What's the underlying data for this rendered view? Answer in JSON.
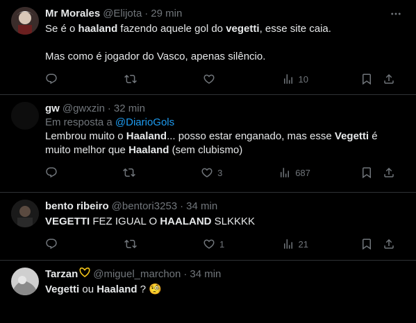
{
  "tweets": [
    {
      "name": "Mr Morales",
      "handle": "@Elijota",
      "time": "29 min",
      "text1_a": "Se é o ",
      "text1_b": "haaland",
      "text1_c": " fazendo aquele gol do ",
      "text1_d": "vegetti",
      "text1_e": ", esse site caia.",
      "text2": "Mas como é jogador do Vasco, apenas  silêncio.",
      "replies": "",
      "retweets": "",
      "likes": "",
      "views": "10"
    },
    {
      "name": "gw",
      "handle": "@gwxzin",
      "time": "32 min",
      "reply_prefix": "Em resposta a ",
      "reply_mention": "@DiarioGols",
      "t_a": "Lembrou muito o ",
      "t_b": "Haaland",
      "t_c": "... posso estar enganado, mas esse ",
      "t_d": "Vegetti",
      "t_e": " é muito melhor que ",
      "t_f": "Haaland",
      "t_g": " (sem clubismo)",
      "replies": "",
      "retweets": "",
      "likes": "3",
      "views": "687"
    },
    {
      "name": "bento ribeiro",
      "handle": "@bentori3253",
      "time": "34 min",
      "t_a": "VEGETTI",
      "t_b": " FEZ IGUAL O ",
      "t_c": "HAALAND",
      "t_d": " SLKKKK",
      "replies": "",
      "retweets": "",
      "likes": "1",
      "views": "21"
    },
    {
      "name": "Tarzan",
      "handle": "@miguel_marchon",
      "time": "34 min",
      "t_a": "Vegetti",
      "t_b": " ou ",
      "t_c": "Haaland",
      "t_d": " ? 🧐"
    }
  ],
  "separator": "·",
  "colors": {
    "background": "#000000",
    "text": "#e7e9ea",
    "muted": "#71767b",
    "link": "#1d9bf0",
    "border": "#2f3336"
  }
}
